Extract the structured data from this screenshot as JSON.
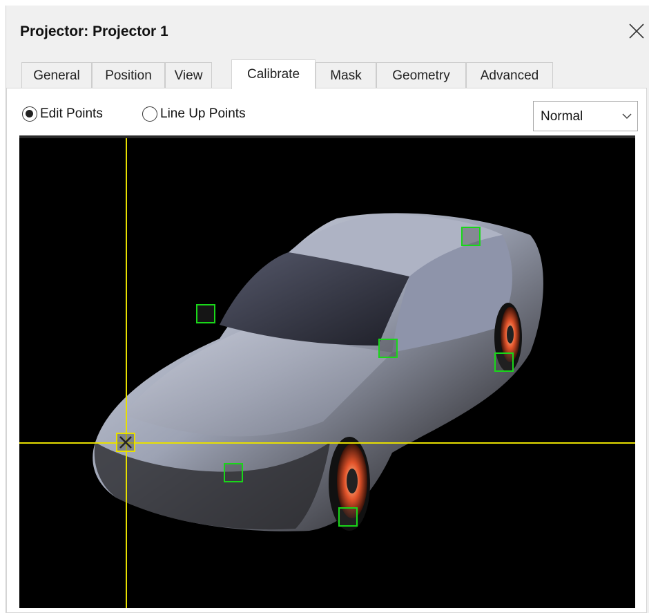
{
  "window": {
    "title": "Projector: Projector 1"
  },
  "tabs": [
    {
      "label": "General",
      "active": false
    },
    {
      "label": "Position",
      "active": false
    },
    {
      "label": "View",
      "active": false
    },
    {
      "label": "Calibrate",
      "active": true
    },
    {
      "label": "Mask",
      "active": false
    },
    {
      "label": "Geometry",
      "active": false
    },
    {
      "label": "Advanced",
      "active": false
    }
  ],
  "mode": {
    "edit_points": {
      "label": "Edit Points",
      "checked": true
    },
    "line_up_points": {
      "label": "Line Up Points",
      "checked": false
    }
  },
  "view_select": {
    "value": "Normal"
  },
  "colors": {
    "point_marker": "#19d719",
    "selected_marker": "#e8e000",
    "crosshair": "#e8e000",
    "viewport_bg": "#000000"
  },
  "icons": {
    "close": "close-icon",
    "dropdown": "chevron-down-icon"
  }
}
